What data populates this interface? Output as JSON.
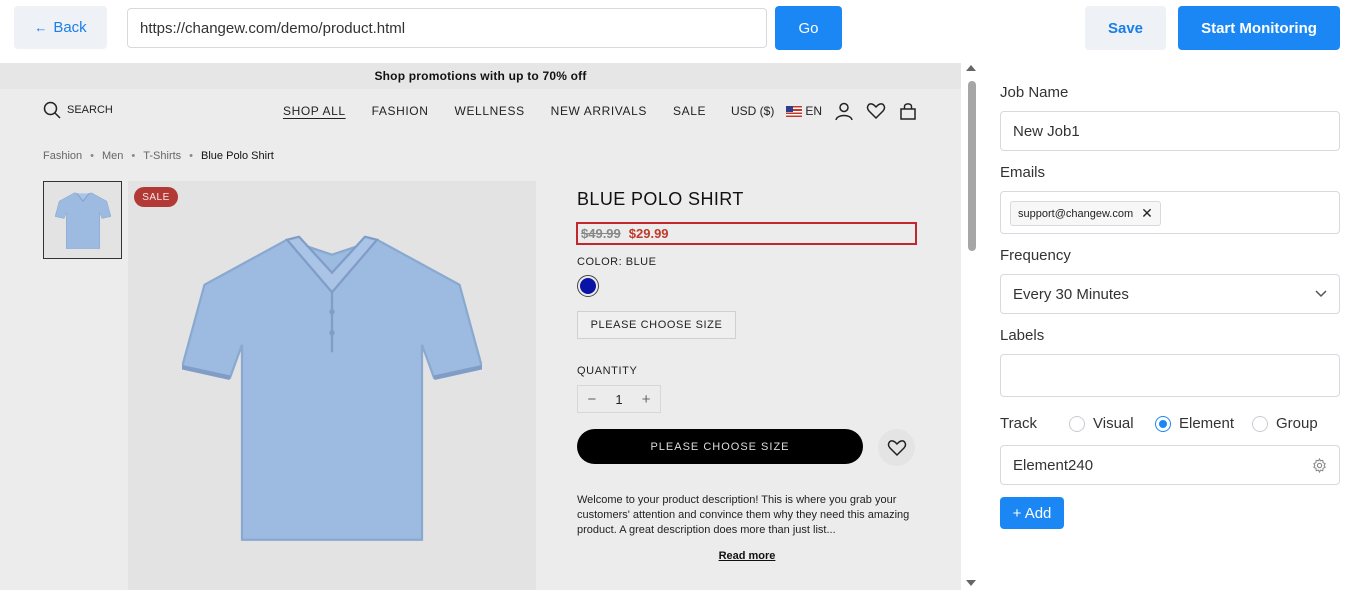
{
  "toolbar": {
    "back_label": "Back",
    "url_value": "https://changew.com/demo/product.html",
    "go_label": "Go",
    "save_label": "Save",
    "start_label": "Start Monitoring"
  },
  "preview": {
    "promo": "Shop promotions with up to 70% off",
    "search_label": "SEARCH",
    "nav": [
      "SHOP ALL",
      "FASHION",
      "WELLNESS",
      "NEW ARRIVALS",
      "SALE"
    ],
    "currency": "USD ($)",
    "language": "EN",
    "breadcrumb": [
      "Fashion",
      "Men",
      "T-Shirts",
      "Blue Polo Shirt"
    ],
    "sale_badge": "SALE",
    "product_title": "BLUE POLO SHIRT",
    "price_old": "$49.99",
    "price_new": "$29.99",
    "color_label": "COLOR: BLUE",
    "swatch_color": "#0a13a6",
    "size_button": "PLEASE CHOOSE SIZE",
    "quantity_label": "QUANTITY",
    "quantity_value": "1",
    "cta_label": "PLEASE CHOOSE SIZE",
    "description": "Welcome to your product description! This is where you grab your customers' attention and convince them why they need this amazing product. A great description does more than just list...",
    "read_more": "Read more",
    "highlight_color": "#c1272d"
  },
  "panel": {
    "job_name_label": "Job Name",
    "job_name_value": "New Job1",
    "emails_label": "Emails",
    "email_tag": "support@changew.com",
    "frequency_label": "Frequency",
    "frequency_value": "Every 30 Minutes",
    "labels_label": "Labels",
    "labels_value": "",
    "track_label": "Track",
    "track_options": [
      "Visual",
      "Element",
      "Group"
    ],
    "track_selected": "Element",
    "element_value": "Element240",
    "add_label": "+ Add"
  },
  "colors": {
    "accent": "#1a87f5",
    "secondary_button": "#eef1f5"
  }
}
